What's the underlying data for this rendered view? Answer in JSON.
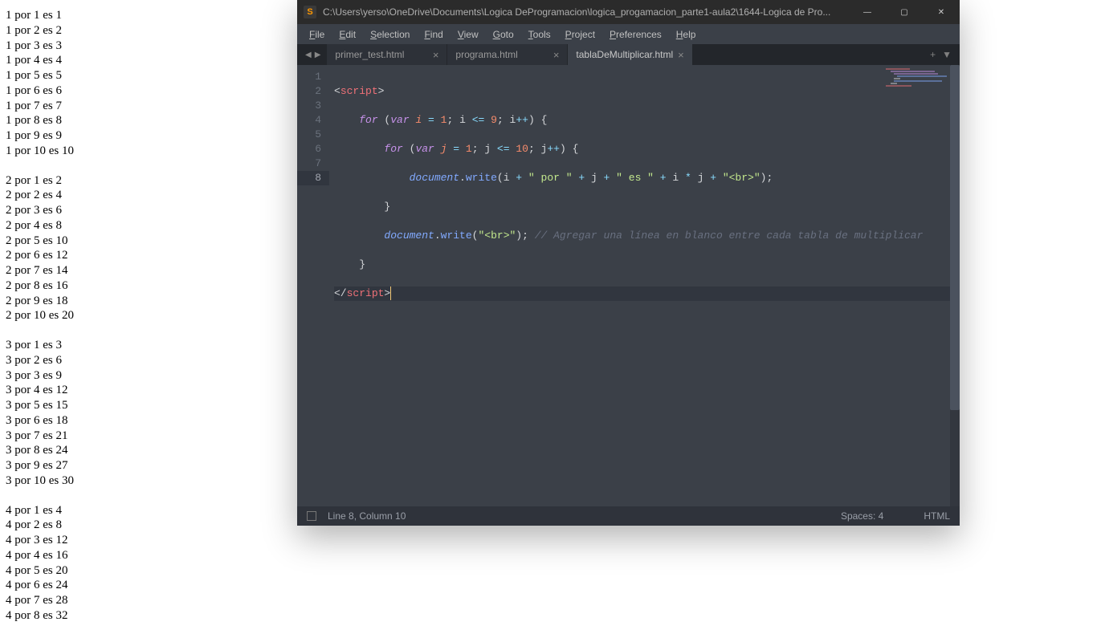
{
  "browser_tables": [
    [
      "1 por 1 es 1",
      "1 por 2 es 2",
      "1 por 3 es 3",
      "1 por 4 es 4",
      "1 por 5 es 5",
      "1 por 6 es 6",
      "1 por 7 es 7",
      "1 por 8 es 8",
      "1 por 9 es 9",
      "1 por 10 es 10"
    ],
    [
      "2 por 1 es 2",
      "2 por 2 es 4",
      "2 por 3 es 6",
      "2 por 4 es 8",
      "2 por 5 es 10",
      "2 por 6 es 12",
      "2 por 7 es 14",
      "2 por 8 es 16",
      "2 por 9 es 18",
      "2 por 10 es 20"
    ],
    [
      "3 por 1 es 3",
      "3 por 2 es 6",
      "3 por 3 es 9",
      "3 por 4 es 12",
      "3 por 5 es 15",
      "3 por 6 es 18",
      "3 por 7 es 21",
      "3 por 8 es 24",
      "3 por 9 es 27",
      "3 por 10 es 30"
    ],
    [
      "4 por 1 es 4",
      "4 por 2 es 8",
      "4 por 3 es 12",
      "4 por 4 es 16",
      "4 por 5 es 20",
      "4 por 6 es 24",
      "4 por 7 es 28",
      "4 por 8 es 32"
    ]
  ],
  "window": {
    "app_icon_letter": "S",
    "title": "C:\\Users\\yerso\\OneDrive\\Documents\\Logica DeProgramacion\\logica_progamacion_parte1-aula2\\1644-Logica de Pro...",
    "controls": {
      "min": "—",
      "max": "▢",
      "close": "✕"
    }
  },
  "menu": [
    "File",
    "Edit",
    "Selection",
    "Find",
    "View",
    "Goto",
    "Tools",
    "Project",
    "Preferences",
    "Help"
  ],
  "tabs": {
    "back": "◀",
    "forward": "▶",
    "items": [
      {
        "label": "primer_test.html",
        "active": false
      },
      {
        "label": "programa.html",
        "active": false
      },
      {
        "label": "tablaDeMultiplicar.html",
        "active": true
      }
    ],
    "close_glyph": "×",
    "extra": {
      "plus": "+",
      "down": "▼"
    }
  },
  "gutter": [
    "1",
    "2",
    "3",
    "4",
    "5",
    "6",
    "7",
    "8"
  ],
  "active_line": 8,
  "code": {
    "l1": {
      "a": "<",
      "b": "script",
      "c": ">"
    },
    "l2": {
      "indent": "    ",
      "for": "for",
      "paren": " (",
      "var": "var",
      "v": " i ",
      "eq": "=",
      "sp": " ",
      "n1": "1",
      "semi": "; ",
      "v2": "i ",
      "le": "<=",
      "sp2": " ",
      "n9": "9",
      "semi2": "; ",
      "v3": "i",
      "inc": "++",
      "close": ") {"
    },
    "l3": {
      "indent": "        ",
      "for": "for",
      "paren": " (",
      "var": "var",
      "v": " j ",
      "eq": "=",
      "sp": " ",
      "n1": "1",
      "semi": "; ",
      "v2": "j ",
      "le": "<=",
      "sp2": " ",
      "n10": "10",
      "semi2": "; ",
      "v3": "j",
      "inc": "++",
      "close": ") {"
    },
    "l4": {
      "indent": "            ",
      "obj": "document",
      "dot": ".",
      "fn": "write",
      "open": "(",
      "v1": "i ",
      "plus1": "+",
      "s1": " \" por \" ",
      "plus2": "+",
      "v2": " j ",
      "plus3": "+",
      "s2": " \" es \" ",
      "plus4": "+",
      "v3": " i ",
      "star": "*",
      "v4": " j ",
      "plus5": "+",
      "s3": " \"<br>\"",
      "close": ");"
    },
    "l5": {
      "indent": "        ",
      "brace": "}"
    },
    "l6": {
      "indent": "        ",
      "obj": "document",
      "dot": ".",
      "fn": "write",
      "open": "(",
      "s": "\"<br>\"",
      "close": "); ",
      "com": "// Agregar una línea en blanco entre cada tabla de multiplicar"
    },
    "l7": {
      "indent": "    ",
      "brace": "}"
    },
    "l8": {
      "a": "</",
      "b": "script",
      "c": ">"
    }
  },
  "status": {
    "position": "Line 8, Column 10",
    "spaces": "Spaces: 4",
    "syntax": "HTML"
  }
}
